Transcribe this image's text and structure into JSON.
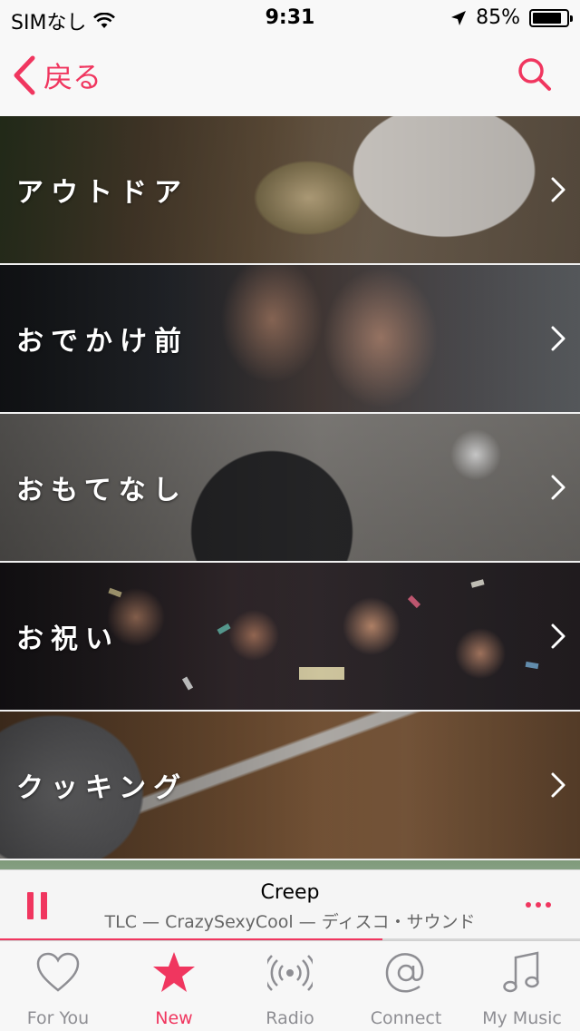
{
  "status_bar": {
    "carrier": "SIMなし",
    "time": "9:31",
    "battery_percent_text": "85%",
    "battery_level": 0.85
  },
  "nav": {
    "back_label": "戻る"
  },
  "categories": [
    {
      "label": "アウトドア"
    },
    {
      "label": "おでかけ前"
    },
    {
      "label": "おもてなし"
    },
    {
      "label": "お祝い"
    },
    {
      "label": "クッキング"
    }
  ],
  "now_playing": {
    "title": "Creep",
    "subtitle": "TLC — CrazySexyCool — ディスコ・サウンド",
    "progress": 0.66
  },
  "tabs": [
    {
      "label": "For You",
      "icon": "heart-icon"
    },
    {
      "label": "New",
      "icon": "star-icon"
    },
    {
      "label": "Radio",
      "icon": "radio-icon"
    },
    {
      "label": "Connect",
      "icon": "at-sign-icon"
    },
    {
      "label": "My Music",
      "icon": "music-note-icon"
    }
  ],
  "colors": {
    "accent": "#f0365f",
    "inactive": "#8e8e93"
  }
}
